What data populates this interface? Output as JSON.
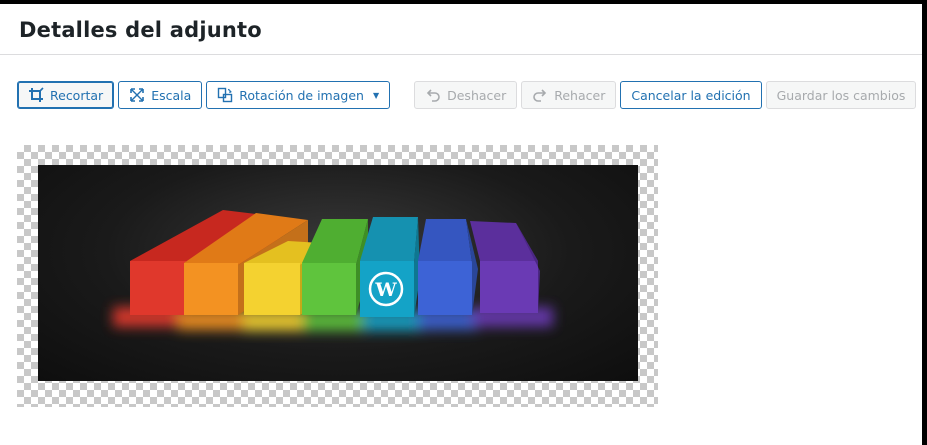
{
  "modal": {
    "title": "Detalles del adjunto"
  },
  "toolbar": {
    "crop_label": "Recortar",
    "scale_label": "Escala",
    "rotate_label": "Rotación de imagen",
    "undo_label": "Deshacer",
    "redo_label": "Rehacer",
    "cancel_label": "Cancelar la edición",
    "save_label": "Guardar los cambios"
  },
  "icons": {
    "crop": "crop-icon",
    "scale": "scale-icon",
    "rotate": "rotate-icon",
    "undo": "undo-icon",
    "redo": "redo-icon",
    "logo": "wordpress-logo-icon"
  },
  "image": {
    "chalk_colors": [
      "#e23a2f",
      "#f39222",
      "#f4d230",
      "#5fc43d",
      "#14a3c7",
      "#3d63d6",
      "#6a3ab4"
    ],
    "accent": "#2271b1"
  }
}
